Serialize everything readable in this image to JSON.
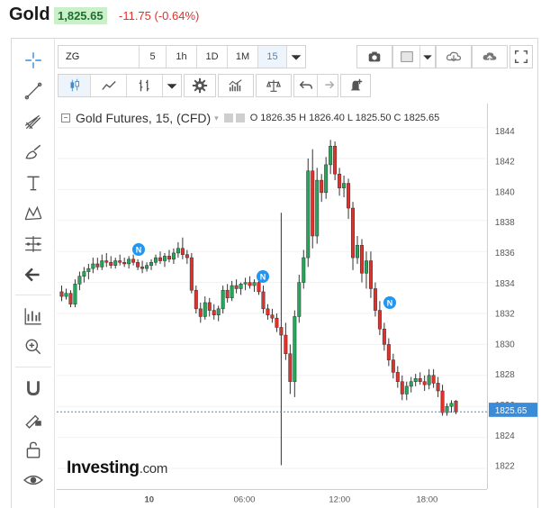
{
  "header": {
    "title": "Gold",
    "price": "1,825.65",
    "change": "-11.75 (-0.64%)"
  },
  "toolbar": {
    "symbol": "ZG",
    "intervals": [
      "5",
      "1h",
      "1D",
      "1M",
      "15"
    ],
    "active_interval": "15",
    "icons": [
      "chevron-down-icon",
      "camera-icon",
      "color-swatch-icon",
      "cloud-download-icon",
      "cloud-upload-icon",
      "fullscreen-icon"
    ]
  },
  "toolbar2": {
    "icons": [
      "candlestick-icon",
      "line-chart-icon",
      "compare-icon",
      "settings-icon",
      "indicators-icon",
      "balance-icon",
      "undo-icon",
      "redo-icon",
      "alert-icon"
    ]
  },
  "left_toolbar": {
    "icons": [
      "crosshair-icon",
      "trend-line-icon",
      "pitchfork-icon",
      "brush-icon",
      "text-icon",
      "pattern-icon",
      "fib-icon",
      "back-arrow-icon",
      "measure-icon",
      "zoom-icon",
      "magnet-icon",
      "lock-drawing-icon",
      "unlock-icon",
      "eye-icon"
    ]
  },
  "legend": {
    "title": "Gold Futures, 15, (CFD)",
    "ohlc": "O 1826.35  H 1826.40  L 1825.50  C 1825.65"
  },
  "watermark": {
    "brand": "Investing",
    "suffix": ".com"
  },
  "colors": {
    "up": "#26a65b",
    "down": "#e0312a",
    "accent": "#3a8bd8",
    "last_price_bg": "#3a8bd8",
    "news_marker": "#2196f3"
  },
  "chart_data": {
    "type": "candlestick",
    "ylim": [
      1821,
      1845
    ],
    "yticks": [
      1822,
      1824,
      1826,
      1828,
      1830,
      1832,
      1834,
      1836,
      1838,
      1840,
      1842,
      1844
    ],
    "xticks": [
      "10",
      "06:00",
      "12:00",
      "18:00"
    ],
    "last_price": "1825.65",
    "news_markers": [
      "N",
      "N",
      "N"
    ],
    "candles": [
      {
        "o": 1833.4,
        "h": 1833.8,
        "l": 1832.8,
        "c": 1833.1
      },
      {
        "o": 1833.1,
        "h": 1833.6,
        "l": 1832.9,
        "c": 1833.3
      },
      {
        "o": 1833.3,
        "h": 1833.5,
        "l": 1832.4,
        "c": 1832.6
      },
      {
        "o": 1832.6,
        "h": 1834.2,
        "l": 1832.4,
        "c": 1833.9
      },
      {
        "o": 1833.9,
        "h": 1834.7,
        "l": 1833.5,
        "c": 1834.4
      },
      {
        "o": 1834.4,
        "h": 1835.0,
        "l": 1834.0,
        "c": 1834.7
      },
      {
        "o": 1834.7,
        "h": 1835.2,
        "l": 1834.2,
        "c": 1834.9
      },
      {
        "o": 1834.9,
        "h": 1835.6,
        "l": 1834.6,
        "c": 1835.2
      },
      {
        "o": 1835.2,
        "h": 1835.6,
        "l": 1834.8,
        "c": 1835.0
      },
      {
        "o": 1835.0,
        "h": 1835.8,
        "l": 1834.8,
        "c": 1835.4
      },
      {
        "o": 1835.4,
        "h": 1835.9,
        "l": 1835.0,
        "c": 1835.3
      },
      {
        "o": 1835.3,
        "h": 1835.7,
        "l": 1834.9,
        "c": 1835.1
      },
      {
        "o": 1835.1,
        "h": 1835.6,
        "l": 1834.9,
        "c": 1835.4
      },
      {
        "o": 1835.4,
        "h": 1835.8,
        "l": 1835.1,
        "c": 1835.3
      },
      {
        "o": 1835.3,
        "h": 1835.6,
        "l": 1835.0,
        "c": 1835.2
      },
      {
        "o": 1835.2,
        "h": 1835.7,
        "l": 1834.9,
        "c": 1835.5
      },
      {
        "o": 1835.5,
        "h": 1835.8,
        "l": 1835.1,
        "c": 1835.3
      },
      {
        "o": 1835.3,
        "h": 1835.5,
        "l": 1834.8,
        "c": 1835.0
      },
      {
        "o": 1835.0,
        "h": 1835.4,
        "l": 1834.6,
        "c": 1834.9
      },
      {
        "o": 1834.9,
        "h": 1835.3,
        "l": 1834.7,
        "c": 1835.1
      },
      {
        "o": 1835.1,
        "h": 1835.5,
        "l": 1834.8,
        "c": 1835.3
      },
      {
        "o": 1835.3,
        "h": 1835.8,
        "l": 1835.1,
        "c": 1835.6
      },
      {
        "o": 1835.6,
        "h": 1836.0,
        "l": 1835.2,
        "c": 1835.4
      },
      {
        "o": 1835.4,
        "h": 1835.9,
        "l": 1835.0,
        "c": 1835.7
      },
      {
        "o": 1835.7,
        "h": 1836.1,
        "l": 1835.3,
        "c": 1835.5
      },
      {
        "o": 1835.5,
        "h": 1836.2,
        "l": 1835.2,
        "c": 1835.9
      },
      {
        "o": 1835.9,
        "h": 1836.6,
        "l": 1835.6,
        "c": 1836.2
      },
      {
        "o": 1836.2,
        "h": 1836.9,
        "l": 1835.5,
        "c": 1835.8
      },
      {
        "o": 1835.8,
        "h": 1836.1,
        "l": 1835.2,
        "c": 1835.6
      },
      {
        "o": 1835.6,
        "h": 1835.9,
        "l": 1833.3,
        "c": 1833.5
      },
      {
        "o": 1833.5,
        "h": 1833.8,
        "l": 1832.0,
        "c": 1832.3
      },
      {
        "o": 1832.3,
        "h": 1832.7,
        "l": 1831.4,
        "c": 1831.8
      },
      {
        "o": 1831.8,
        "h": 1833.1,
        "l": 1831.6,
        "c": 1832.7
      },
      {
        "o": 1832.7,
        "h": 1833.0,
        "l": 1831.8,
        "c": 1832.2
      },
      {
        "o": 1832.2,
        "h": 1832.6,
        "l": 1831.6,
        "c": 1831.9
      },
      {
        "o": 1831.9,
        "h": 1832.5,
        "l": 1831.5,
        "c": 1832.3
      },
      {
        "o": 1832.3,
        "h": 1833.8,
        "l": 1832.0,
        "c": 1833.5
      },
      {
        "o": 1833.5,
        "h": 1833.9,
        "l": 1832.7,
        "c": 1833.0
      },
      {
        "o": 1833.0,
        "h": 1834.1,
        "l": 1832.8,
        "c": 1833.8
      },
      {
        "o": 1833.8,
        "h": 1834.2,
        "l": 1833.3,
        "c": 1833.6
      },
      {
        "o": 1833.6,
        "h": 1834.0,
        "l": 1833.2,
        "c": 1833.9
      },
      {
        "o": 1833.9,
        "h": 1834.3,
        "l": 1833.5,
        "c": 1834.0
      },
      {
        "o": 1834.0,
        "h": 1834.4,
        "l": 1833.6,
        "c": 1833.8
      },
      {
        "o": 1833.8,
        "h": 1834.2,
        "l": 1833.4,
        "c": 1834.0
      },
      {
        "o": 1834.0,
        "h": 1834.3,
        "l": 1833.2,
        "c": 1833.4
      },
      {
        "o": 1833.4,
        "h": 1833.8,
        "l": 1832.0,
        "c": 1832.3
      },
      {
        "o": 1832.3,
        "h": 1832.6,
        "l": 1831.6,
        "c": 1831.9
      },
      {
        "o": 1831.9,
        "h": 1832.3,
        "l": 1831.4,
        "c": 1831.7
      },
      {
        "o": 1831.7,
        "h": 1832.0,
        "l": 1830.8,
        "c": 1831.1
      },
      {
        "o": 1831.1,
        "h": 1838.5,
        "l": 1822.2,
        "c": 1830.6
      },
      {
        "o": 1830.6,
        "h": 1831.4,
        "l": 1829.0,
        "c": 1829.4
      },
      {
        "o": 1829.4,
        "h": 1830.0,
        "l": 1826.8,
        "c": 1827.6
      },
      {
        "o": 1827.6,
        "h": 1832.2,
        "l": 1826.6,
        "c": 1831.8
      },
      {
        "o": 1831.8,
        "h": 1834.5,
        "l": 1831.4,
        "c": 1834.0
      },
      {
        "o": 1834.0,
        "h": 1836.1,
        "l": 1833.6,
        "c": 1835.6
      },
      {
        "o": 1835.6,
        "h": 1842.0,
        "l": 1835.0,
        "c": 1841.2
      },
      {
        "o": 1841.2,
        "h": 1842.6,
        "l": 1836.2,
        "c": 1837.0
      },
      {
        "o": 1837.0,
        "h": 1841.4,
        "l": 1836.5,
        "c": 1840.6
      },
      {
        "o": 1840.6,
        "h": 1841.0,
        "l": 1839.2,
        "c": 1839.8
      },
      {
        "o": 1839.8,
        "h": 1842.1,
        "l": 1839.4,
        "c": 1841.6
      },
      {
        "o": 1841.6,
        "h": 1843.2,
        "l": 1841.0,
        "c": 1842.8
      },
      {
        "o": 1842.8,
        "h": 1843.1,
        "l": 1840.6,
        "c": 1841.0
      },
      {
        "o": 1841.0,
        "h": 1841.4,
        "l": 1839.6,
        "c": 1840.1
      },
      {
        "o": 1840.1,
        "h": 1840.9,
        "l": 1839.5,
        "c": 1840.4
      },
      {
        "o": 1840.4,
        "h": 1840.7,
        "l": 1838.1,
        "c": 1838.8
      },
      {
        "o": 1838.8,
        "h": 1839.2,
        "l": 1834.8,
        "c": 1835.6
      },
      {
        "o": 1835.6,
        "h": 1837.0,
        "l": 1835.2,
        "c": 1836.4
      },
      {
        "o": 1836.4,
        "h": 1836.8,
        "l": 1834.0,
        "c": 1834.6
      },
      {
        "o": 1834.6,
        "h": 1836.0,
        "l": 1833.6,
        "c": 1835.4
      },
      {
        "o": 1835.4,
        "h": 1836.0,
        "l": 1833.0,
        "c": 1833.6
      },
      {
        "o": 1833.6,
        "h": 1834.0,
        "l": 1831.8,
        "c": 1832.2
      },
      {
        "o": 1832.2,
        "h": 1832.8,
        "l": 1830.6,
        "c": 1831.0
      },
      {
        "o": 1831.0,
        "h": 1831.4,
        "l": 1829.6,
        "c": 1830.0
      },
      {
        "o": 1830.0,
        "h": 1830.4,
        "l": 1828.6,
        "c": 1829.0
      },
      {
        "o": 1829.0,
        "h": 1829.4,
        "l": 1827.8,
        "c": 1828.2
      },
      {
        "o": 1828.2,
        "h": 1828.6,
        "l": 1827.2,
        "c": 1827.6
      },
      {
        "o": 1827.6,
        "h": 1828.0,
        "l": 1826.4,
        "c": 1826.8
      },
      {
        "o": 1826.8,
        "h": 1827.6,
        "l": 1826.4,
        "c": 1827.3
      },
      {
        "o": 1827.3,
        "h": 1827.9,
        "l": 1826.9,
        "c": 1827.6
      },
      {
        "o": 1827.6,
        "h": 1828.1,
        "l": 1827.3,
        "c": 1827.8
      },
      {
        "o": 1827.8,
        "h": 1828.2,
        "l": 1827.4,
        "c": 1827.6
      },
      {
        "o": 1827.6,
        "h": 1828.0,
        "l": 1827.0,
        "c": 1827.4
      },
      {
        "o": 1827.4,
        "h": 1828.4,
        "l": 1827.1,
        "c": 1828.0
      },
      {
        "o": 1828.0,
        "h": 1828.4,
        "l": 1827.2,
        "c": 1827.5
      },
      {
        "o": 1827.5,
        "h": 1827.9,
        "l": 1826.6,
        "c": 1827.0
      },
      {
        "o": 1827.0,
        "h": 1827.4,
        "l": 1825.4,
        "c": 1825.6
      },
      {
        "o": 1825.6,
        "h": 1826.2,
        "l": 1825.4,
        "c": 1826.0
      },
      {
        "o": 1826.0,
        "h": 1826.4,
        "l": 1825.6,
        "c": 1826.2
      },
      {
        "o": 1826.35,
        "h": 1826.4,
        "l": 1825.5,
        "c": 1825.65
      }
    ]
  }
}
